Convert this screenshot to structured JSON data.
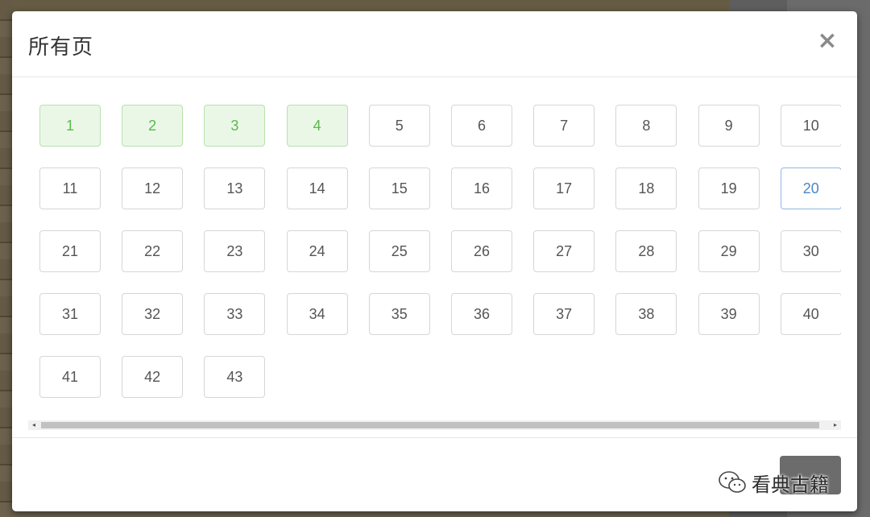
{
  "modal": {
    "title": "所有页",
    "close_label": "×"
  },
  "pages": [
    {
      "label": "1",
      "state": "read"
    },
    {
      "label": "2",
      "state": "read"
    },
    {
      "label": "3",
      "state": "read"
    },
    {
      "label": "4",
      "state": "read"
    },
    {
      "label": "5",
      "state": "unread"
    },
    {
      "label": "6",
      "state": "unread"
    },
    {
      "label": "7",
      "state": "unread"
    },
    {
      "label": "8",
      "state": "unread"
    },
    {
      "label": "9",
      "state": "unread"
    },
    {
      "label": "10",
      "state": "unread"
    },
    {
      "label": "11",
      "state": "unread"
    },
    {
      "label": "12",
      "state": "unread"
    },
    {
      "label": "13",
      "state": "unread"
    },
    {
      "label": "14",
      "state": "unread"
    },
    {
      "label": "15",
      "state": "unread"
    },
    {
      "label": "16",
      "state": "unread"
    },
    {
      "label": "17",
      "state": "unread"
    },
    {
      "label": "18",
      "state": "unread"
    },
    {
      "label": "19",
      "state": "unread"
    },
    {
      "label": "20",
      "state": "current"
    },
    {
      "label": "21",
      "state": "unread"
    },
    {
      "label": "22",
      "state": "unread"
    },
    {
      "label": "23",
      "state": "unread"
    },
    {
      "label": "24",
      "state": "unread"
    },
    {
      "label": "25",
      "state": "unread"
    },
    {
      "label": "26",
      "state": "unread"
    },
    {
      "label": "27",
      "state": "unread"
    },
    {
      "label": "28",
      "state": "unread"
    },
    {
      "label": "29",
      "state": "unread"
    },
    {
      "label": "30",
      "state": "unread"
    },
    {
      "label": "31",
      "state": "unread"
    },
    {
      "label": "32",
      "state": "unread"
    },
    {
      "label": "33",
      "state": "unread"
    },
    {
      "label": "34",
      "state": "unread"
    },
    {
      "label": "35",
      "state": "unread"
    },
    {
      "label": "36",
      "state": "unread"
    },
    {
      "label": "37",
      "state": "unread"
    },
    {
      "label": "38",
      "state": "unread"
    },
    {
      "label": "39",
      "state": "unread"
    },
    {
      "label": "40",
      "state": "unread"
    },
    {
      "label": "41",
      "state": "unread"
    },
    {
      "label": "42",
      "state": "unread"
    },
    {
      "label": "43",
      "state": "unread"
    }
  ],
  "colors": {
    "read_bg": "#eaf7e7",
    "read_text": "#5bb94d",
    "current_text": "#4a87c8",
    "footer_button": "#6c6c6c"
  },
  "footer": {
    "watermark_text": "看典古籍",
    "watermark_icon": "wechat-icon"
  }
}
